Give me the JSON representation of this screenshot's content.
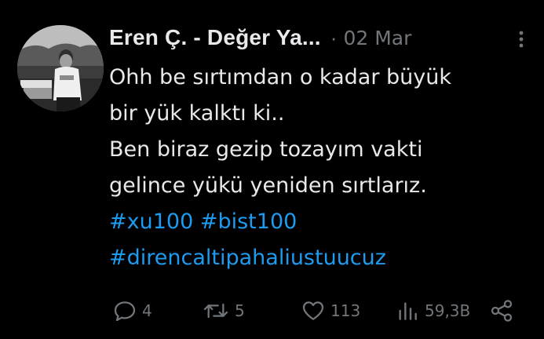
{
  "tweet": {
    "author": {
      "display_name": "Eren Ç. - Değer Ya...",
      "avatar_icon": "profile-photo-avatar"
    },
    "separator": "·",
    "date": "02 Mar",
    "text_lines": [
      "Ohh be sırtımdan o kadar büyük",
      "bir yük kalktı ki..",
      "Ben biraz gezip tozayım vakti",
      "gelince yükü yeniden sırtlarız."
    ],
    "hashtags_line1": [
      "#xu100",
      "#bist100"
    ],
    "hashtags_line2": [
      "#direncaltipahaliustuucuz"
    ],
    "actions": {
      "replies": "4",
      "retweets": "5",
      "likes": "113",
      "views": "59,3B"
    }
  },
  "colors": {
    "background": "#000000",
    "text": "#e7e9ea",
    "muted": "#71767b",
    "link": "#1d9bf0"
  }
}
